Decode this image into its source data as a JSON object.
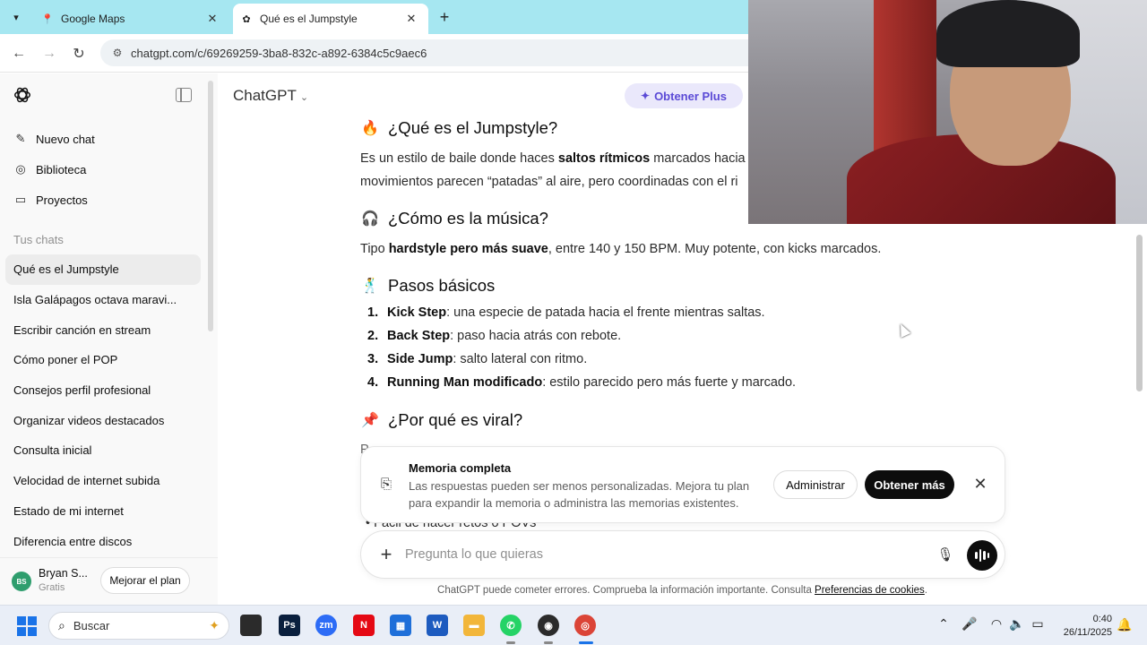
{
  "browser": {
    "tabs": [
      {
        "title": "Google Maps",
        "favicon": "maps-pin-icon",
        "active": false
      },
      {
        "title": "Qué es el Jumpstyle",
        "favicon": "chatgpt-icon",
        "active": true
      }
    ],
    "url": "chatgpt.com/c/69269259-3ba8-832c-a892-6384c5c9aec6"
  },
  "sidebar": {
    "actions": [
      {
        "label": "Nuevo chat",
        "icon": "edit-icon"
      },
      {
        "label": "Biblioteca",
        "icon": "library-icon"
      },
      {
        "label": "Proyectos",
        "icon": "folder-icon"
      }
    ],
    "section_label": "Tus chats",
    "chats": [
      "Qué es el Jumpstyle",
      "Isla Galápagos octava maravi...",
      "Escribir canción en stream",
      "Cómo poner el POP",
      "Consejos perfil profesional",
      "Organizar videos destacados",
      "Consulta inicial",
      "Velocidad de internet subida",
      "Estado de mi internet",
      "Diferencia entre discos"
    ],
    "user": {
      "initials": "BS",
      "name": "Bryan S...",
      "plan": "Gratis",
      "upgrade_label": "Mejorar el plan"
    }
  },
  "header": {
    "model": "ChatGPT",
    "plus_label": "Obtener Plus"
  },
  "content": {
    "h1": {
      "emoji": "🔥",
      "text": "¿Qué es el Jumpstyle?"
    },
    "p1_line1": {
      "pre": "Es un estilo de baile donde haces ",
      "bold": "saltos rítmicos",
      "post": " marcados hacia a"
    },
    "p1_line2": "movimientos parecen “patadas” al aire, pero coordinadas con el ri",
    "h2": {
      "emoji": "🎧",
      "text": "¿Cómo es la música?"
    },
    "p2": {
      "pre": "Tipo ",
      "bold": "hardstyle pero más suave",
      "post": ", entre 140 y 150 BPM. Muy potente, con kicks marcados."
    },
    "h3": {
      "emoji": "🕺",
      "text": "Pasos básicos"
    },
    "steps": [
      {
        "num": "1.",
        "bold": "Kick Step",
        "text": ": una especie de patada hacia el frente mientras saltas."
      },
      {
        "num": "2.",
        "bold": "Back Step",
        "text": ": paso hacia atrás con rebote."
      },
      {
        "num": "3.",
        "bold": "Side Jump",
        "text": ": salto lateral con ritmo."
      },
      {
        "num": "4.",
        "bold": "Running Man modificado",
        "text": ": estilo parecido pero más fuerte y marcado."
      }
    ],
    "h4": {
      "emoji": "📌",
      "text": "¿Por qué es viral?"
    },
    "cut_text": "P",
    "cut_bullet": "• Fácil de hacer retos o POVs"
  },
  "memory": {
    "title": "Memoria completa",
    "text": "Las respuestas pueden ser menos personalizadas. Mejora tu plan para expandir la memoria o administra las memorias existentes.",
    "manage_label": "Administrar",
    "more_label": "Obtener más"
  },
  "composer": {
    "placeholder": "Pregunta lo que quieras"
  },
  "disclaimer": {
    "text": "ChatGPT puede cometer errores. Comprueba la información importante. Consulta ",
    "link": "Preferencias de cookies",
    "end": "."
  },
  "taskbar": {
    "search_label": "Buscar",
    "time": "0:40",
    "date": "26/11/2025",
    "apps": [
      {
        "name": "file-explorer-dark",
        "label": "",
        "color": "#2b2b2b"
      },
      {
        "name": "photoshop",
        "label": "Ps",
        "color": "#0a1f3d"
      },
      {
        "name": "zoom",
        "label": "zm",
        "color": "#2d6cf6"
      },
      {
        "name": "netflix",
        "label": "N",
        "color": "#e50914"
      },
      {
        "name": "store",
        "label": "▦",
        "color": "#1e6fd9"
      },
      {
        "name": "word",
        "label": "W",
        "color": "#1d5bbf"
      },
      {
        "name": "explorer",
        "label": "▬",
        "color": "#f2b63a"
      },
      {
        "name": "whatsapp",
        "label": "✆",
        "color": "#25d366"
      },
      {
        "name": "app-dark",
        "label": "◉",
        "color": "#2b2b2b"
      },
      {
        "name": "chrome",
        "label": "◎",
        "color": "#db4437"
      }
    ]
  }
}
